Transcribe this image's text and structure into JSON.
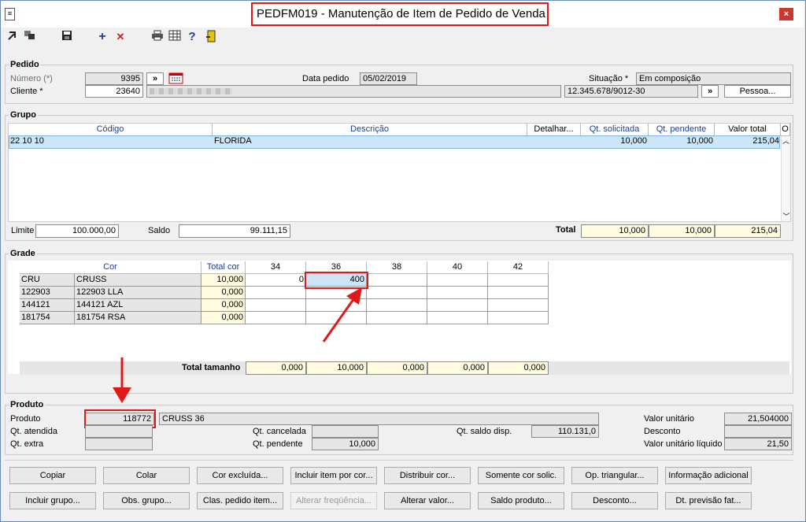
{
  "window": {
    "title": "PEDFM019 - Manutenção de Item de Pedido de Venda",
    "close_glyph": "×"
  },
  "pedido": {
    "section": "Pedido",
    "numero_label": "Número (*)",
    "numero_value": "9395",
    "cliente_label": "Cliente *",
    "cliente_value": "23640",
    "data_label": "Data pedido",
    "data_value": "05/02/2019",
    "situacao_label": "Situação *",
    "situacao_value": "Em composição",
    "cnpj_value": "12.345.678/9012-30",
    "pessoa_button": "Pessoa...",
    "nav_glyph": "»"
  },
  "grupo": {
    "section": "Grupo",
    "headers": [
      "Código",
      "Descrição",
      "Detalhar...",
      "Qt. solicitada",
      "Qt. pendente",
      "Valor total",
      "O"
    ],
    "row": {
      "codigo": "22 10 10",
      "descricao": "FLORIDA",
      "qt_solicitada": "10,000",
      "qt_pendente": "10,000",
      "valor_total": "215,04"
    },
    "limite_label": "Limite",
    "limite_value": "100.000,00",
    "saldo_label": "Saldo",
    "saldo_value": "99.111,15",
    "total_label": "Total",
    "total_qt_solicitada": "10,000",
    "total_qt_pendente": "10,000",
    "total_valor": "215,04"
  },
  "grade": {
    "section": "Grade",
    "headers": {
      "cor": "Cor",
      "total_cor": "Total cor",
      "sizes": [
        "34",
        "36",
        "38",
        "40",
        "42"
      ]
    },
    "rows": [
      {
        "code": "CRU",
        "name": "CRUSS",
        "total": "10,000",
        "s34": "0",
        "s36": "400"
      },
      {
        "code": "122903",
        "name": "122903 LLA",
        "total": "0,000",
        "s34": "",
        "s36": ""
      },
      {
        "code": "144121",
        "name": "144121 AZL",
        "total": "0,000",
        "s34": "",
        "s36": ""
      },
      {
        "code": "181754",
        "name": "181754 RSA",
        "total": "0,000",
        "s34": "",
        "s36": ""
      }
    ],
    "total_tamanho_label": "Total tamanho",
    "totals": [
      "0,000",
      "10,000",
      "0,000",
      "0,000",
      "0,000"
    ]
  },
  "produto": {
    "section": "Produto",
    "produto_label": "Produto",
    "produto_code": "118772",
    "produto_desc": "CRUSS 36",
    "qt_atendida_label": "Qt. atendida",
    "qt_extra_label": "Qt. extra",
    "qt_cancelada_label": "Qt. cancelada",
    "qt_pendente_label": "Qt. pendente",
    "qt_pendente_value": "10,000",
    "qt_saldo_label": "Qt. saldo disp.",
    "qt_saldo_value": "110.131,0",
    "valor_unitario_label": "Valor unitário",
    "valor_unitario_value": "21,504000",
    "desconto_label": "Desconto",
    "valor_liquido_label": "Valor unitário líquido",
    "valor_liquido_value": "21,50"
  },
  "buttons_row1": [
    "Copiar",
    "Colar",
    "Cor excluída...",
    "Incluir item por cor...",
    "Distribuir cor...",
    "Somente cor solic.",
    "Op. triangular...",
    "Informação adicional"
  ],
  "buttons_row2": [
    "Incluir grupo...",
    "Obs. grupo...",
    "Clas. pedido item...",
    "Alterar freqüência...",
    "Alterar valor...",
    "Saldo produto...",
    "Desconto...",
    "Dt. previsão fat..."
  ],
  "toolbar": {
    "add": "+",
    "delete": "✕",
    "help": "?"
  },
  "colors": {
    "highlight": "#e01818",
    "selection": "#cde6f7",
    "total_bg": "#fffbe0"
  }
}
